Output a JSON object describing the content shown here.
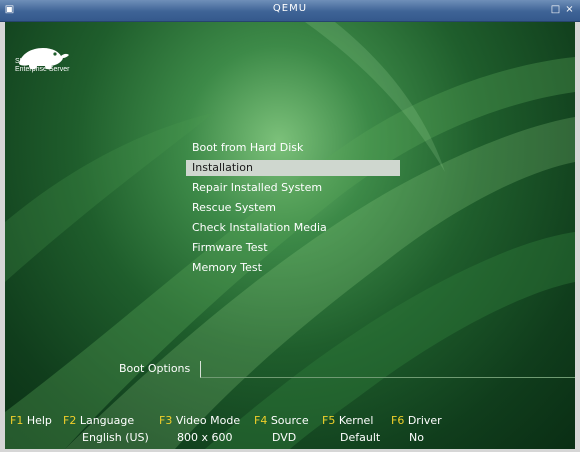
{
  "window": {
    "title": "QEMU",
    "menu_icon": "window-menu-icon",
    "maximize_icon": "maximize-icon",
    "close_icon": "close-icon"
  },
  "branding": {
    "logo_icon": "suse-chameleon-logo",
    "line1": "SUSE. Linux",
    "line2": "Enterprise Server"
  },
  "boot_menu": {
    "items": [
      {
        "label": "Boot from Hard Disk",
        "selected": false
      },
      {
        "label": "Installation",
        "selected": true
      },
      {
        "label": "Repair Installed System",
        "selected": false
      },
      {
        "label": "Rescue System",
        "selected": false
      },
      {
        "label": "Check Installation Media",
        "selected": false
      },
      {
        "label": "Firmware Test",
        "selected": false
      },
      {
        "label": "Memory Test",
        "selected": false
      }
    ]
  },
  "boot_options": {
    "label": "Boot Options",
    "value": ""
  },
  "function_keys": [
    {
      "key": "F1",
      "label": "Help",
      "value": ""
    },
    {
      "key": "F2",
      "label": "Language",
      "value": "English (US)"
    },
    {
      "key": "F3",
      "label": "Video Mode",
      "value": "800 x 600"
    },
    {
      "key": "F4",
      "label": "Source",
      "value": "DVD"
    },
    {
      "key": "F5",
      "label": "Kernel",
      "value": "Default"
    },
    {
      "key": "F6",
      "label": "Driver",
      "value": "No"
    }
  ],
  "colors": {
    "function_key": "#f0cf2a",
    "selection_bg": "#cfd7cf",
    "titlebar": "#3e6396"
  }
}
